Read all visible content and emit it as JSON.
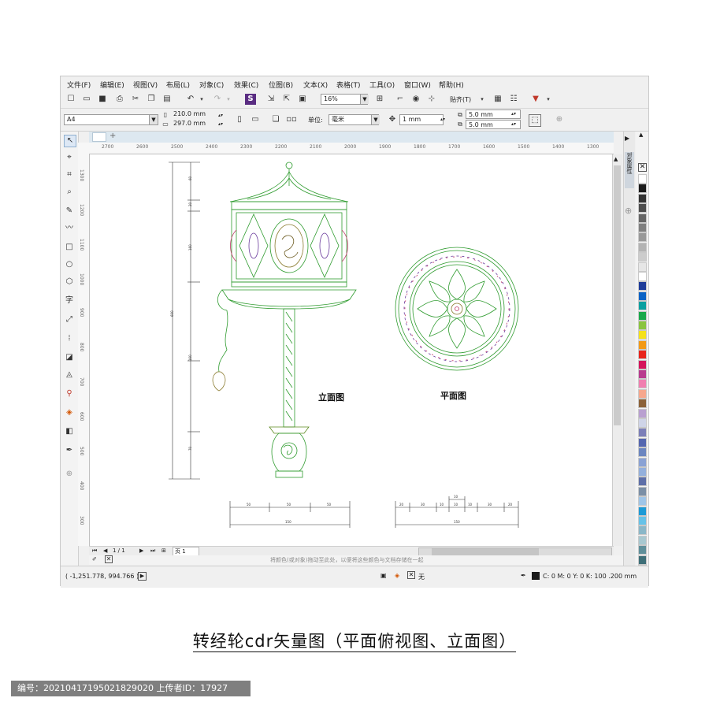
{
  "menu": [
    "文件(F)",
    "编辑(E)",
    "视图(V)",
    "布局(L)",
    "对象(C)",
    "效果(C)",
    "位图(B)",
    "文本(X)",
    "表格(T)",
    "工具(O)",
    "窗口(W)",
    "帮助(H)"
  ],
  "toolbar": {
    "zoom_value": "16%",
    "snap_label": "贴齐(T)"
  },
  "property_bar": {
    "page_size": "A4",
    "width": "210.0 mm",
    "height": "297.0 mm",
    "units_label": "单位:",
    "units_value": "毫米",
    "nudge": "1 mm",
    "dup_x": "5.0 mm",
    "dup_y": "5.0 mm"
  },
  "ruler": {
    "h_ticks": [
      "2700",
      "2600",
      "2500",
      "2400",
      "2300",
      "2200",
      "2100",
      "2000",
      "1900",
      "1800",
      "1700",
      "1600",
      "1500",
      "1400",
      "1300"
    ],
    "v_ticks": [
      "1300",
      "1200",
      "1100",
      "1000",
      "900",
      "800",
      "700",
      "600",
      "500",
      "400",
      "300"
    ]
  },
  "drawing": {
    "elevation_label": "立面图",
    "plan_label": "平面图",
    "vertical_dims": [
      "60",
      "20",
      "160",
      "600",
      "160",
      "70"
    ],
    "elevation_dims_top": [
      "50",
      "50",
      "50"
    ],
    "elevation_dim_total": "150",
    "plan_dims_top": [
      "20",
      "30",
      "10",
      "10",
      "10",
      "30",
      "20"
    ],
    "plan_dim_small": "10",
    "plan_dim_total": "150"
  },
  "pager": {
    "page_count": "1 / 1",
    "page_tab": "页 1"
  },
  "fill_hint": "将颜色(或对象)拖动至此处，以便将这些颜色与文档存储在一起",
  "status": {
    "coords": "( -1,251.778, 994.766 )",
    "fill_none": "无",
    "outline_info": "C: 0 M: 0 Y: 0 K: 100  .200 mm"
  },
  "docker_tab": "对象属性",
  "palette_colors": [
    "#ffffff",
    "#1a1a1a",
    "#333333",
    "#4d4d4d",
    "#666666",
    "#808080",
    "#999999",
    "#b3b3b3",
    "#cccccc",
    "#e6e6e6",
    "#ffffff",
    "#1f3d99",
    "#0b63c5",
    "#0aa0a0",
    "#1aa84a",
    "#8ac43f",
    "#f5e11b",
    "#f29a17",
    "#e8241c",
    "#d4145a",
    "#b83b8e",
    "#f07fb0",
    "#f6a78e",
    "#8c6239",
    "#b9a0d0",
    "#cfd4e8",
    "#7c7fb8",
    "#5567b0",
    "#6c86c0",
    "#8aa2d4",
    "#94b0dc",
    "#5e6fa8",
    "#7b8fa6",
    "#9fc5e8",
    "#1c9ad6",
    "#66c2e8",
    "#8ab7c8",
    "#a8c8d0",
    "#5f8f9a",
    "#3e6f78",
    "#76a8a0",
    "#4f8f7a"
  ],
  "caption": "转经轮cdr矢量图（平面俯视图、立面图）",
  "footer": "编号：20210417195021829020  上传者ID：17927"
}
